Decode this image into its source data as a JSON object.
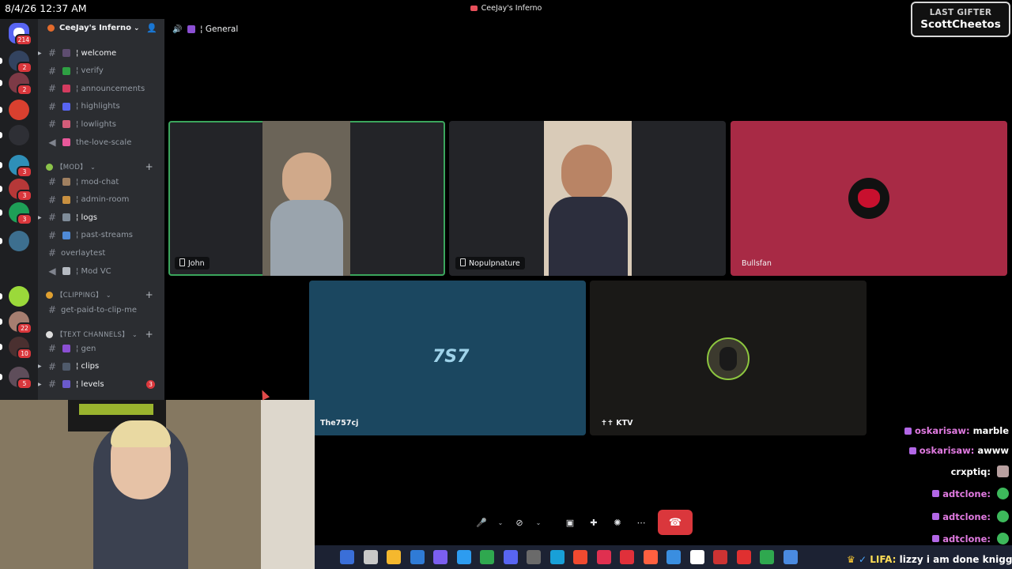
{
  "overlay": {
    "datetime": "8/4/26 12:37 AM",
    "gifter_label": "LAST GIFTER",
    "gifter_name": "ScottCheetos",
    "ticker_prefix": "LIFA:",
    "ticker_text": "lizzy i am done knigga"
  },
  "window": {
    "title": "CeeJay's Inferno"
  },
  "rail": {
    "home_badge": "214",
    "servers": [
      {
        "badge": "2",
        "color": "#33435f"
      },
      {
        "badge": "2",
        "color": "#7d3a46"
      },
      {
        "badge": "",
        "color": "#d9402f"
      },
      {
        "badge": "",
        "color": "#2e2f35"
      },
      {
        "badge": "3",
        "color": "#2f8fb8"
      },
      {
        "badge": "3",
        "color": "#b63838"
      },
      {
        "badge": "3",
        "color": "#1e9f57"
      },
      {
        "badge": "",
        "color": "#3d6f8f"
      },
      {
        "badge": "",
        "color": "#9bd93a"
      },
      {
        "badge": "22",
        "color": "#a67e70"
      },
      {
        "badge": "10",
        "color": "#4a3030"
      },
      {
        "badge": "5",
        "color": "#5e4d5a"
      }
    ]
  },
  "server": {
    "name": "CeeJay's Inferno",
    "channels_top": [
      {
        "name": "¦ welcome",
        "emo": "#5e4d70",
        "bright": true
      },
      {
        "name": "¦ verify",
        "emo": "#2ea043"
      },
      {
        "name": "¦ announcements",
        "emo": "#d43b5f"
      },
      {
        "name": "¦ highlights",
        "emo": "#5865f2"
      },
      {
        "name": "¦ lowlights",
        "emo": "#d45d79"
      },
      {
        "name": "the-love-scale",
        "emo": "#e8589a",
        "speaker": true
      }
    ],
    "cat_mod": "【MOD】",
    "channels_mod": [
      {
        "name": "¦ mod-chat",
        "emo": "#a08060"
      },
      {
        "name": "¦ admin-room",
        "emo": "#c89040"
      },
      {
        "name": "¦ logs",
        "emo": "#7f8c99",
        "bright": true
      },
      {
        "name": "¦ past-streams",
        "emo": "#4f8ad6"
      },
      {
        "name": "overlaytest",
        "emo": ""
      },
      {
        "name": "¦ Mod VC",
        "emo": "#b5bac1",
        "speaker": true
      }
    ],
    "cat_clipping": "【CLIPPING】",
    "channels_clip": [
      {
        "name": "get-paid-to-clip-me",
        "emo": ""
      }
    ],
    "cat_text": "【TEXT CHANNELS】",
    "channels_text": [
      {
        "name": "¦ gen",
        "emo": "#8b4fd3"
      },
      {
        "name": "¦ clips",
        "emo": "#4f5a6b",
        "bright": true
      },
      {
        "name": "¦ levels",
        "emo": "#6a5acd",
        "bright": true,
        "ping": "3"
      }
    ]
  },
  "voice": {
    "channel": "¦ General",
    "participants": [
      {
        "name": "John",
        "mobile": true,
        "speaking": true
      },
      {
        "name": "Nopulpnature",
        "mobile": true
      },
      {
        "name": "Bullsfan"
      },
      {
        "name": "The757cj"
      },
      {
        "name": "✝✝ KTV"
      }
    ]
  },
  "chat": [
    {
      "user": "oskarisaw:",
      "text": "marble",
      "sub": true
    },
    {
      "user": "oskarisaw:",
      "text": "awww",
      "sub": true
    },
    {
      "user": "crxptiq:",
      "text": "",
      "sub": false,
      "emote": true,
      "plain": true
    },
    {
      "user": "adtclone:",
      "text": "",
      "sub": true,
      "emote": true
    },
    {
      "user": "adtclone:",
      "text": "",
      "sub": true,
      "emote": true
    },
    {
      "user": "adtclone:",
      "text": "",
      "sub": true,
      "emote": true
    }
  ],
  "colors": {
    "speaking": "#3ba55c",
    "hangup": "#da373c",
    "bulls_bg": "#a82a45",
    "757_bg": "#1b4760"
  }
}
